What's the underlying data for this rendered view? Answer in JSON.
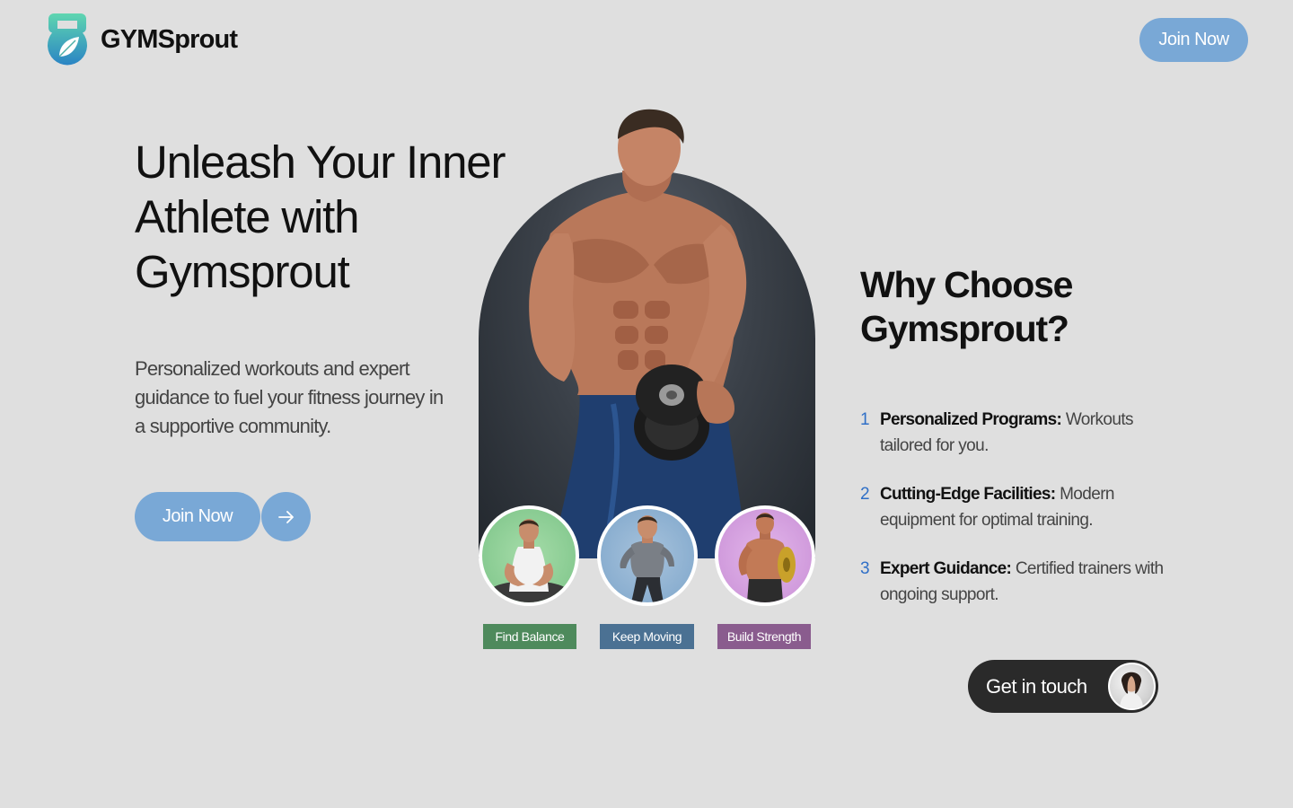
{
  "brand": {
    "name": "GYMSprout",
    "logo_icon": "kettlebell-leaf-icon"
  },
  "header": {
    "join_label": "Join Now"
  },
  "hero": {
    "title": "Unleash Your Inner Athlete with Gymsprout",
    "subtitle": "Personalized workouts and expert guidance to fuel your fitness journey in a supportive community.",
    "cta_label": "Join Now",
    "cta_icon": "arrow-right-icon"
  },
  "showcase": {
    "items": [
      {
        "label": "Find Balance",
        "color": "#4e8a5c"
      },
      {
        "label": "Keep Moving",
        "color": "#4b7193"
      },
      {
        "label": "Build Strength",
        "color": "#8a5c8e"
      }
    ]
  },
  "why": {
    "title": "Why Choose Gymsprout?",
    "features": [
      {
        "num": "1",
        "title": "Personalized Programs:",
        "text": "Workouts tailored for you."
      },
      {
        "num": "2",
        "title": "Cutting-Edge Facilities:",
        "text": "Modern equipment for optimal training."
      },
      {
        "num": "3",
        "title": "Expert Guidance:",
        "text": "Certified trainers with ongoing support."
      }
    ]
  },
  "contact": {
    "label": "Get in touch"
  },
  "colors": {
    "accent": "#79a8d6",
    "dark": "#2a2a2a",
    "number": "#2f6fc7",
    "background": "#dfdfdf"
  }
}
